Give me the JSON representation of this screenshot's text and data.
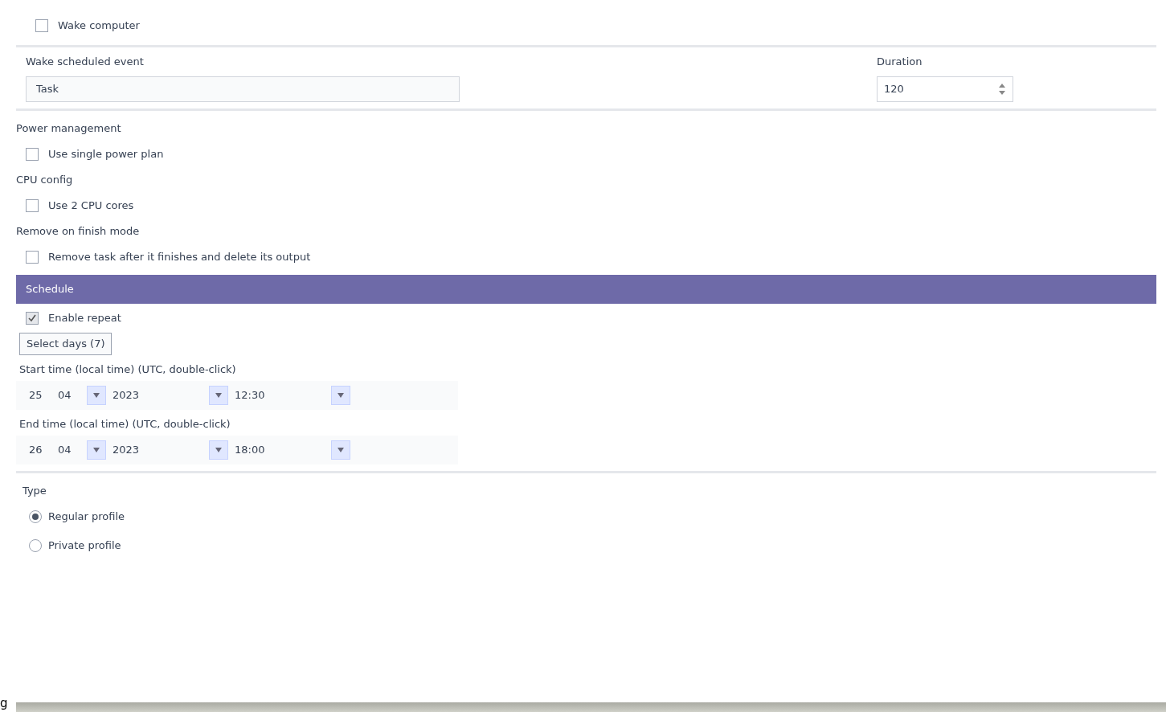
{
  "wake": {
    "label": "Wake computer",
    "checked": false
  },
  "event": {
    "label": "Wake scheduled event",
    "value": "Task"
  },
  "duration": {
    "label": "Duration",
    "value": "120"
  },
  "sections": [
    {
      "title": "Power management",
      "option": {
        "kind": "checkbox",
        "label": "Use single power plan",
        "checked": false
      }
    },
    {
      "title": "CPU config",
      "option": {
        "kind": "checkbox",
        "label": "Use 2 CPU cores",
        "checked": false
      }
    },
    {
      "title": "Remove on finish mode",
      "option": {
        "kind": "checkbox",
        "label": "Remove task after it finishes and delete its output",
        "checked": false
      }
    }
  ],
  "schedule_bar": {
    "label": "Schedule"
  },
  "repeat": {
    "label": "Enable repeat",
    "checked": true
  },
  "days_button": "Select days (7)",
  "times": [
    {
      "label": "Start time (local time) (UTC, double-click)",
      "day": "25",
      "month": "04",
      "year": "2023",
      "time": "12:30"
    },
    {
      "label": "End time (local time) (UTC, double-click)",
      "day": "26",
      "month": "04",
      "year": "2023",
      "time": "18:00"
    }
  ],
  "type": {
    "title": "Type",
    "options": [
      {
        "label": "Regular profile",
        "selected": true
      },
      {
        "label": "Private profile",
        "selected": false
      }
    ]
  },
  "fragment": "g"
}
